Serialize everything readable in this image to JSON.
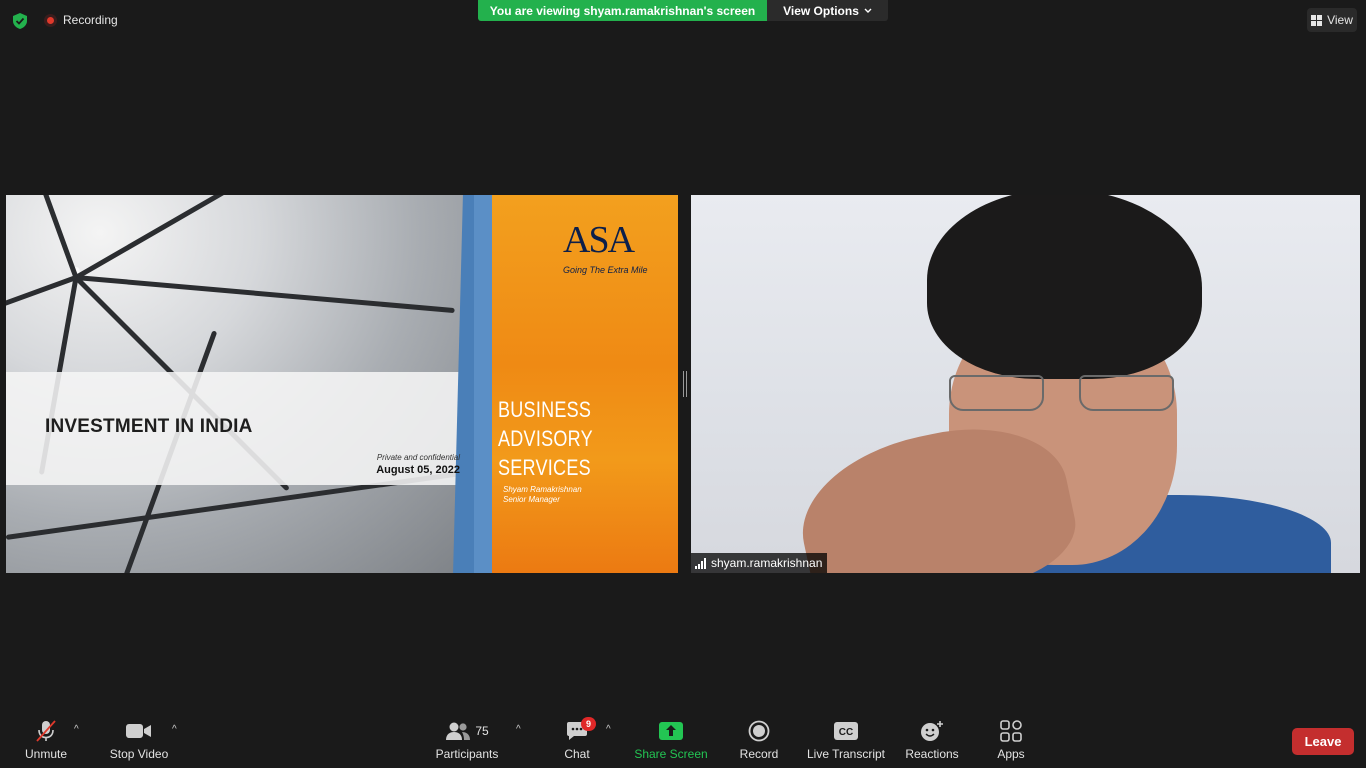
{
  "top_bar": {
    "recording_label": "Recording",
    "viewing_banner": "You are viewing shyam.ramakrishnan's screen",
    "view_options_label": "View Options",
    "view_label": "View"
  },
  "shared_screen": {
    "title": "INVESTMENT IN INDIA",
    "confidential": "Private and confidential",
    "date": "August 05, 2022",
    "logo": "ASA",
    "tagline": "Going The Extra Mile",
    "service_line1": "BUSINESS ADVISORY",
    "service_line2": "SERVICES",
    "presenter_name": "Shyam Ramakrishnan",
    "presenter_role": "Senior Manager"
  },
  "video": {
    "participant_name": "shyam.ramakrishnan"
  },
  "toolbar": {
    "unmute_label": "Unmute",
    "stop_video_label": "Stop Video",
    "participants_label": "Participants",
    "participants_count": "75",
    "chat_label": "Chat",
    "chat_badge": "9",
    "share_screen_label": "Share Screen",
    "record_label": "Record",
    "live_transcript_label": "Live Transcript",
    "reactions_label": "Reactions",
    "apps_label": "Apps",
    "leave_label": "Leave"
  },
  "colors": {
    "background": "#1a1a1a",
    "banner_green": "#23b14d",
    "leave_red": "#c42e2e",
    "slide_orange": "#ef8a14",
    "slide_blue": "#4a7fb8"
  }
}
